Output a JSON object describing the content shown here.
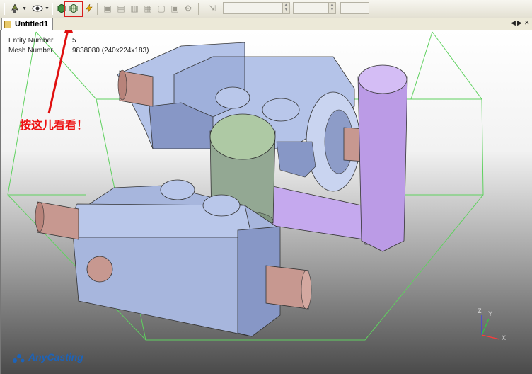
{
  "window": {
    "tab_label": "Untitled1"
  },
  "toolbar": {
    "buttons": [
      {
        "name": "pointer-tool-icon"
      },
      {
        "name": "eye-view-icon"
      },
      {
        "name": "solid-shading-icon"
      },
      {
        "name": "mesh-view-icon"
      },
      {
        "name": "lightning-icon"
      }
    ],
    "highlighted": "mesh-view-icon"
  },
  "info": {
    "entity_label": "Entity Number",
    "entity_value": "5",
    "mesh_label": "Mesh Number",
    "mesh_value": "9838080 (240x224x183)"
  },
  "annotation": {
    "text": "按这儿看看！",
    "color": "#e01010"
  },
  "axes": {
    "x": "X",
    "y": "Y",
    "z": "Z"
  },
  "logo": {
    "text": "AnyCasting"
  },
  "colors": {
    "body": "#b4c3e8",
    "purple": "#c5a9ee",
    "green": "#aec9a4",
    "shaft": "#c79890"
  }
}
